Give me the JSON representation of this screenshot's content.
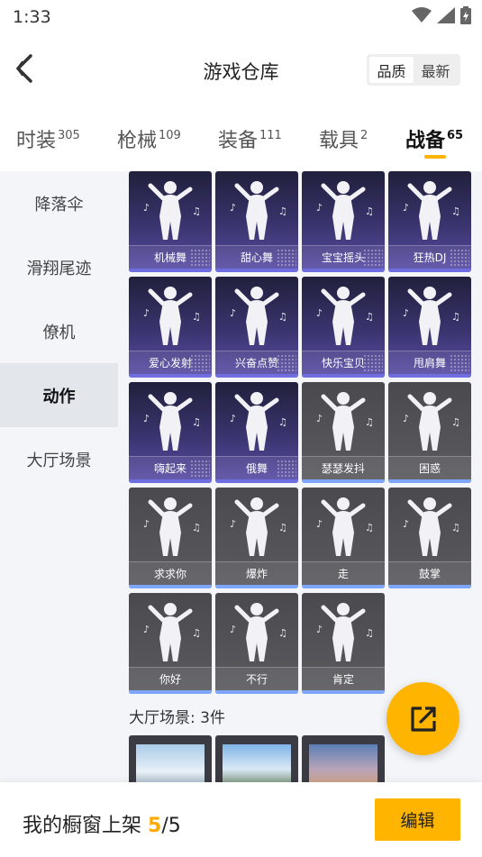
{
  "status_bar": {
    "time": "1:33",
    "icons": [
      "wifi-icon",
      "signal-icon",
      "battery-icon"
    ]
  },
  "header": {
    "title": "游戏仓库",
    "sort_options": [
      {
        "label": "品质",
        "active": true
      },
      {
        "label": "最新",
        "active": false
      }
    ]
  },
  "tabs": [
    {
      "label": "时装",
      "count": "305",
      "active": false
    },
    {
      "label": "枪械",
      "count": "109",
      "active": false
    },
    {
      "label": "装备",
      "count": "111",
      "active": false
    },
    {
      "label": "载具",
      "count": "2",
      "active": false
    },
    {
      "label": "战备",
      "count": "65",
      "active": true
    }
  ],
  "sidebar": {
    "items": [
      {
        "label": "降落伞",
        "active": false
      },
      {
        "label": "滑翔尾迹",
        "active": false
      },
      {
        "label": "僚机",
        "active": false
      },
      {
        "label": "动作",
        "active": true
      },
      {
        "label": "大厅场景",
        "active": false
      }
    ]
  },
  "emotes": [
    {
      "label": "机械舞",
      "owned": true
    },
    {
      "label": "甜心舞",
      "owned": true
    },
    {
      "label": "宝宝摇头",
      "owned": true
    },
    {
      "label": "狂热DJ",
      "owned": true
    },
    {
      "label": "爱心发射",
      "owned": true
    },
    {
      "label": "兴奋点赞",
      "owned": true
    },
    {
      "label": "快乐宝贝",
      "owned": true
    },
    {
      "label": "甩肩舞",
      "owned": true
    },
    {
      "label": "嗨起来",
      "owned": true
    },
    {
      "label": "俄舞",
      "owned": true
    },
    {
      "label": "瑟瑟发抖",
      "owned": false
    },
    {
      "label": "困惑",
      "owned": false
    },
    {
      "label": "求求你",
      "owned": false
    },
    {
      "label": "爆炸",
      "owned": false
    },
    {
      "label": "走",
      "owned": false
    },
    {
      "label": "鼓掌",
      "owned": false
    },
    {
      "label": "你好",
      "owned": false
    },
    {
      "label": "不行",
      "owned": false
    },
    {
      "label": "肯定",
      "owned": false
    }
  ],
  "lobby_section": {
    "title": "大厅场景: 3件"
  },
  "bottom_bar": {
    "prefix": "我的橱窗上架 ",
    "current": "5",
    "separator": "/",
    "total": "5",
    "edit_label": "编辑"
  },
  "colors": {
    "accent": "#ffb400",
    "card_owned": "#3a3570",
    "card_locked": "#55555a"
  }
}
